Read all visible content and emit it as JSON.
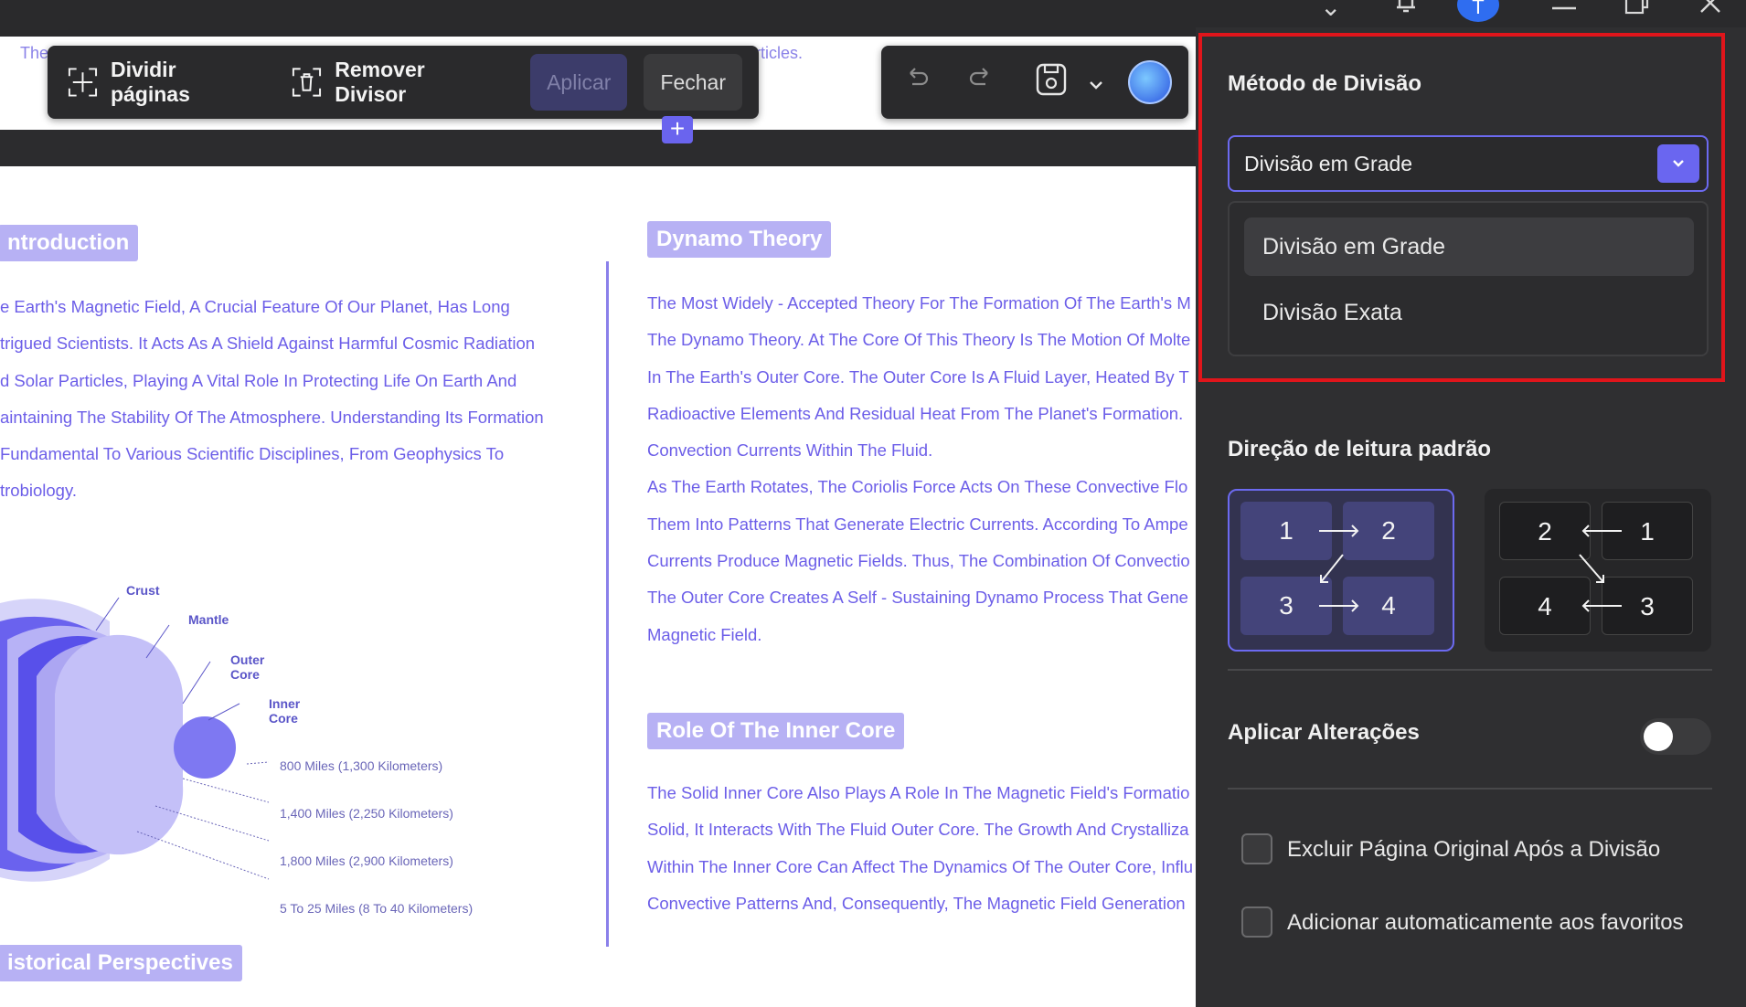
{
  "document": {
    "prev_line_left": "The",
    "prev_line_right": "rticles.",
    "sections": {
      "introduction": {
        "title": "ntroduction",
        "lines": [
          "e Earth's Magnetic Field, A Crucial Feature Of Our Planet, Has Long",
          "trigued Scientists. It Acts As A Shield Against Harmful Cosmic Radiation",
          "d Solar Particles, Playing A Vital Role In Protecting Life On Earth And",
          "aintaining The Stability Of The Atmosphere. Understanding Its Formation",
          "Fundamental To Various Scientific Disciplines, From Geophysics To",
          "trobiology."
        ]
      },
      "dynamo": {
        "title": "Dynamo Theory",
        "lines": [
          "The Most Widely - Accepted Theory For The Formation Of The Earth's M",
          "The Dynamo Theory. At The Core Of This Theory Is The Motion Of Molte",
          "In The Earth's Outer Core. The Outer Core Is A Fluid Layer, Heated By T",
          "Radioactive Elements And Residual Heat From The Planet's Formation.",
          "Convection Currents Within The Fluid.",
          "As The Earth Rotates, The Coriolis Force Acts On These Convective Flo",
          "Them Into Patterns That Generate Electric Currents. According To Ampe",
          "Currents Produce Magnetic Fields. Thus, The Combination Of Convectio",
          "The Outer Core Creates A Self - Sustaining Dynamo Process That Gene",
          "Magnetic Field."
        ]
      },
      "inner_core": {
        "title": "Role Of The Inner Core",
        "lines": [
          "The Solid Inner Core Also Plays A Role In The Magnetic Field's Formatio",
          "Solid, It Interacts With The Fluid Outer Core. The Growth And Crystalliza",
          "Within The Inner Core Can Affect The Dynamics Of The Outer Core, Influ",
          "Convective Patterns And, Consequently, The Magnetic Field Generation"
        ]
      },
      "historical": {
        "title": "istorical Perspectives"
      }
    },
    "diagram": {
      "labels": {
        "crust": "Crust",
        "mantle": "Mantle",
        "outer_core": "Outer Core",
        "inner_core": "Inner Core"
      },
      "measures": [
        "800 Miles (1,300 Kilometers)",
        "1,400 Miles (2,250 Kilometers)",
        "1,800 Miles (2,900 Kilometers)",
        "5 To 25 Miles (8 To 40 Kilometers)"
      ]
    }
  },
  "toolbar": {
    "split_label": "Dividir páginas",
    "remove_label": "Remover Divisor",
    "apply_label": "Aplicar",
    "close_label": "Fechar",
    "add_symbol": "+"
  },
  "panel": {
    "method_title": "Método de Divisão",
    "selected_method": "Divisão em Grade",
    "options": [
      "Divisão em Grade",
      "Divisão Exata"
    ],
    "reading_title": "Direção de leitura padrão",
    "ltr_cells": [
      "1",
      "2",
      "3",
      "4"
    ],
    "rtl_cells": [
      "2",
      "1",
      "4",
      "3"
    ],
    "apply_changes_label": "Aplicar Alterações",
    "apply_changes_on": false,
    "checkbox_delete_label": "Excluir Página Original Após a Divisão",
    "checkbox_favorites_label": "Adicionar automaticamente aos favoritos",
    "checkbox_delete_checked": false,
    "checkbox_favorites_checked": false
  },
  "colors": {
    "accent": "#6a66f0",
    "highlight_border": "#e0151b",
    "doc_text": "#6c5ee8",
    "heading_bg": "#b7b1f4"
  },
  "window": {
    "avatar_initial": "T"
  }
}
